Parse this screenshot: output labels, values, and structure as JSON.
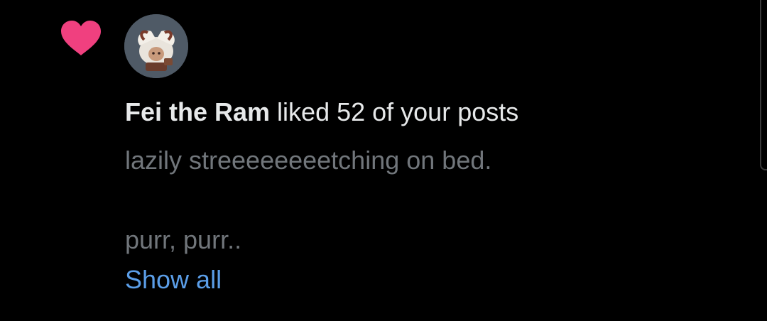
{
  "colors": {
    "background": "#000000",
    "heart": "#f0407f",
    "primary_text": "#e7e9ea",
    "secondary_text": "#71767b",
    "link": "#5b9ee8"
  },
  "icons": {
    "like": "heart-icon",
    "avatar": "user-avatar"
  },
  "notification": {
    "user_name": "Fei the Ram",
    "action_text": " liked 52 of your posts",
    "post_line_1": "lazily streeeeeeeetching on bed.",
    "post_line_2": "purr, purr..",
    "show_all_label": "Show all"
  }
}
